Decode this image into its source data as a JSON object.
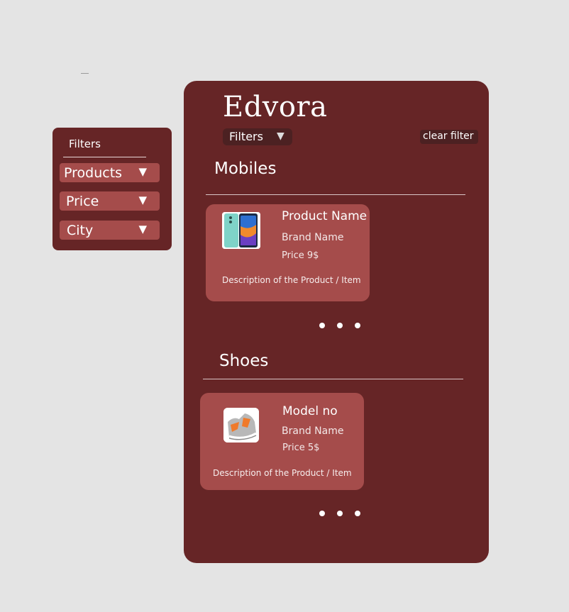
{
  "side_panel": {
    "title": "Filters",
    "dropdowns": [
      {
        "label": "Products",
        "arrow": "▼"
      },
      {
        "label": "Price",
        "arrow": "▼"
      },
      {
        "label": "City",
        "arrow": "▼"
      }
    ]
  },
  "header": {
    "app_title": "Edvora",
    "filters_label": "Filters",
    "filters_arrow": "▼",
    "clear_filter_label": "clear filter"
  },
  "sections": [
    {
      "title": "Mobiles",
      "product": {
        "name": "Product Name",
        "brand": "Brand Name",
        "price": "Price  9$",
        "description": "Description of the Product / Item",
        "image_icon": "smartphone-image"
      }
    },
    {
      "title": "Shoes",
      "product": {
        "name": "Model no",
        "brand": "Brand Name",
        "price": "Price    5$",
        "description": "Description of the Product / Item",
        "image_icon": "sneaker-image"
      }
    }
  ],
  "colors": {
    "page_background": "#e4e4e4",
    "panel_background": "#662526",
    "card_background": "#a54c4b",
    "button_background": "#4c2122"
  }
}
